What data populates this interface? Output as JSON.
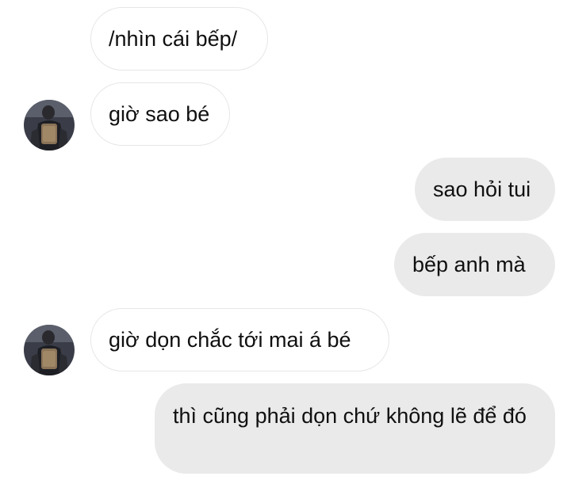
{
  "conversation": {
    "messages": [
      {
        "sender": "other",
        "text": "/nhìn cái bếp/"
      },
      {
        "sender": "other",
        "text": "giờ sao bé"
      },
      {
        "sender": "me",
        "text": "sao hỏi tui"
      },
      {
        "sender": "me",
        "text": "bếp anh mà"
      },
      {
        "sender": "other",
        "text": "giờ dọn chắc tới mai á bé"
      },
      {
        "sender": "me",
        "text": "thì cũng phải dọn chứ không lẽ để đó"
      }
    ]
  },
  "colors": {
    "sent_bubble": "#eaeaea",
    "received_border": "#e6e6e6",
    "text": "#101010"
  }
}
